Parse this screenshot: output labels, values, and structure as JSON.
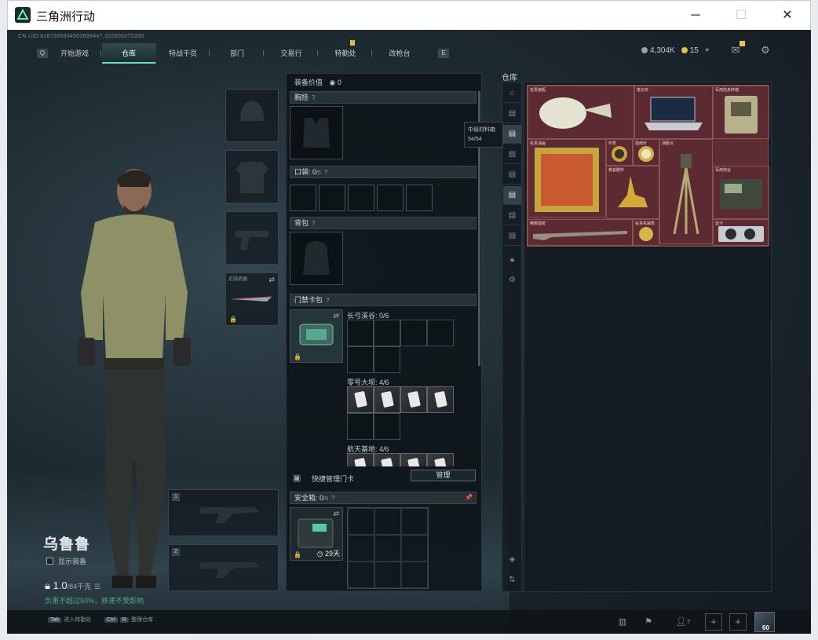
{
  "window": {
    "title": "三角洲行动",
    "minimize": "─",
    "maximize": "☐",
    "close": "✕"
  },
  "uid": "CN UID:8187365904502699447,202605272350",
  "nav": {
    "left_arrow": "Q",
    "right_arrow": "E",
    "tabs": [
      {
        "label": "开始游戏"
      },
      {
        "label": "仓库"
      },
      {
        "label": "特战干员"
      },
      {
        "label": "部门"
      },
      {
        "label": "交易行"
      },
      {
        "label": "特勤处"
      },
      {
        "label": "改枪台"
      }
    ],
    "badge": "!"
  },
  "currency": {
    "coins": "4,304K",
    "tickets": "15",
    "add": "+"
  },
  "character": {
    "name": "乌鲁鲁",
    "show_equipment": "显示装备",
    "weight": "1.0",
    "weight_max": "/84千克",
    "weight_note": "负重不超过50%，移速不受影响"
  },
  "slots": {
    "melee_label": "近战武器",
    "weapon1_num": "1",
    "weapon2_num": "2",
    "lock": "🔒",
    "swap": "⇄"
  },
  "center": {
    "equip_value_label": "装备价值",
    "equip_value": "0",
    "chest_rig": "胸挂",
    "pocket": "口袋:",
    "pocket_count": "0",
    "pocket_unit": "/5",
    "backpack": "背包",
    "keycard_case": "门禁卡包",
    "long_bow": "长弓溪谷: 0/6",
    "zero_dam": "零号大坝: 4/6",
    "space_base": "航天基地: 4/6",
    "quick_manage": "快捷管理门卡",
    "manage_btn": "管理",
    "safe_box": "安全箱:",
    "safe_count": "0",
    "safe_unit": "/9",
    "safe_days": "29天",
    "help": "?",
    "pin": "📌"
  },
  "storage": {
    "title": "仓库",
    "tooltip_name": "中级材料箱",
    "tooltip_count": "54/54",
    "items": [
      {
        "label": "名贵瓷瓶"
      },
      {
        "label": "笔记本"
      },
      {
        "label": "军用信息终端"
      },
      {
        "label": "名贵油画"
      },
      {
        "label": "怀表"
      },
      {
        "label": "指南针"
      },
      {
        "label": "测距仪"
      },
      {
        "label": "黄金瞪羚"
      },
      {
        "label": "军用电台"
      },
      {
        "label": "精致猎枪"
      },
      {
        "label": "名贵机械表"
      },
      {
        "label": "显卡"
      }
    ]
  },
  "bottom": {
    "tab_key": "Tab",
    "tab_hint": "进入特勤处",
    "ctrl_key": "Ctrl",
    "ctrl_key2": "R",
    "ctrl_hint": "整理仓库",
    "friends_count": "7",
    "avatar_level": "60",
    "plus": "+"
  },
  "colors": {
    "accent": "#68e0b0",
    "valuables_bg": "#5c2e34",
    "badge": "#e8c44a"
  }
}
